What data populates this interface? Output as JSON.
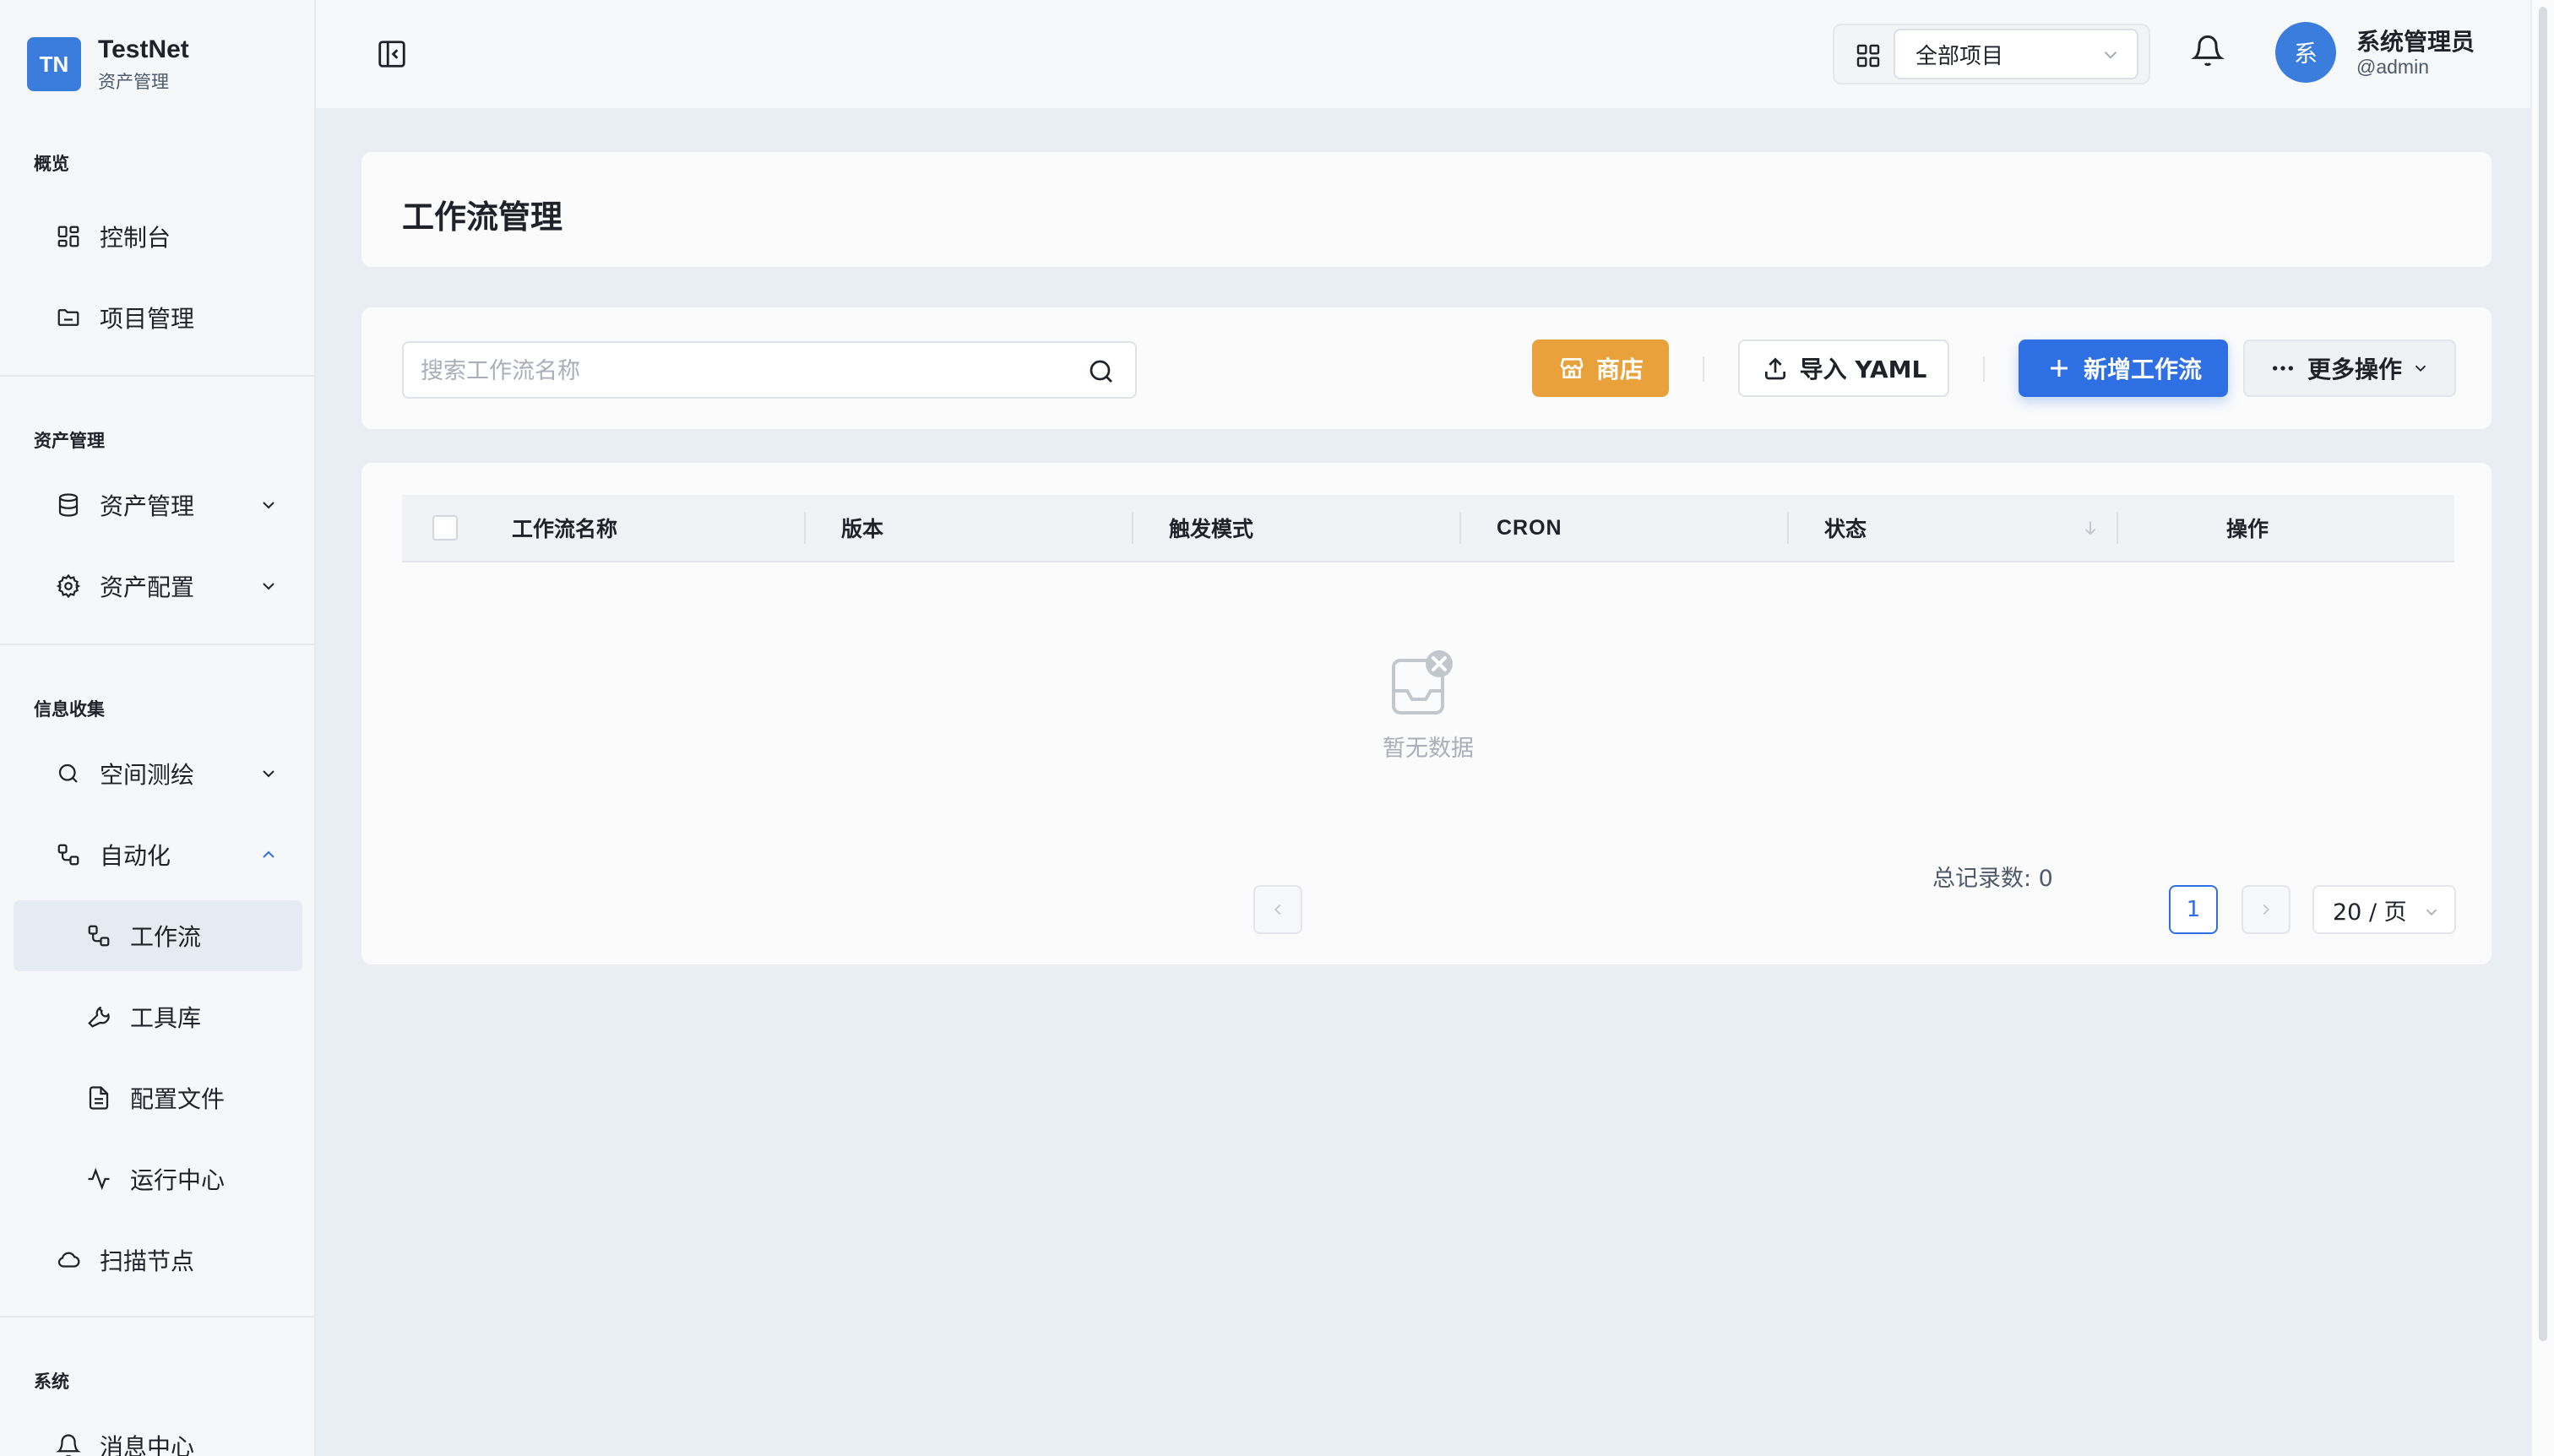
{
  "brand": {
    "logo": "TN",
    "name": "TestNet",
    "subtitle": "资产管理"
  },
  "sidebar": {
    "sections": [
      {
        "title": "概览"
      },
      {
        "title": "资产管理"
      },
      {
        "title": "信息收集"
      },
      {
        "title": "系统"
      }
    ],
    "items": [
      {
        "label": "控制台",
        "icon": "dashboard-icon"
      },
      {
        "label": "项目管理",
        "icon": "folder-icon"
      },
      {
        "label": "资产管理",
        "icon": "database-icon",
        "expanded": false
      },
      {
        "label": "资产配置",
        "icon": "gear-icon",
        "expanded": false
      },
      {
        "label": "空间测绘",
        "icon": "search-icon",
        "expanded": false
      },
      {
        "label": "自动化",
        "icon": "workflow-icon",
        "expanded": true
      },
      {
        "label": "工作流",
        "icon": "workflow-icon",
        "active": true
      },
      {
        "label": "工具库",
        "icon": "wrench-icon"
      },
      {
        "label": "配置文件",
        "icon": "file-icon"
      },
      {
        "label": "运行中心",
        "icon": "activity-icon"
      },
      {
        "label": "扫描节点",
        "icon": "cloud-icon"
      },
      {
        "label": "消息中心",
        "icon": "bell-icon"
      }
    ]
  },
  "header": {
    "project_select": "全部项目",
    "user": {
      "avatar": "系",
      "name": "系统管理员",
      "handle": "@admin"
    }
  },
  "page": {
    "title": "工作流管理"
  },
  "toolbar": {
    "search_placeholder": "搜索工作流名称",
    "shop_label": "商店",
    "import_label": "导入 YAML",
    "new_label": "新增工作流",
    "more_label": "更多操作"
  },
  "table": {
    "columns": [
      "工作流名称",
      "版本",
      "触发模式",
      "CRON",
      "状态",
      "操作"
    ],
    "rows": [],
    "empty_text": "暂无数据"
  },
  "pagination": {
    "total_label": "总记录数: 0",
    "current_page": "1",
    "page_size": "20 / 页"
  },
  "colors": {
    "accent": "#2f6fe4",
    "shop": "#e9a23b",
    "brand": "#3b7ddd"
  }
}
